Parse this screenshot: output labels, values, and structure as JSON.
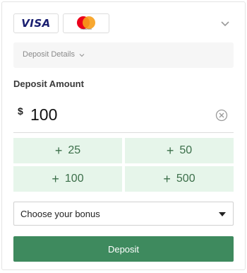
{
  "payment_methods": [
    {
      "name": "VISA",
      "icon": "visa-logo"
    },
    {
      "name": "Mastercard",
      "icon": "mastercard-logo",
      "sublabel": "mastercard"
    }
  ],
  "details": {
    "label": "Deposit Details"
  },
  "deposit": {
    "title": "Deposit Amount",
    "currency": "$",
    "amount": "100"
  },
  "quick_amounts": [
    {
      "plus": "+",
      "value": "25"
    },
    {
      "plus": "+",
      "value": "50"
    },
    {
      "plus": "+",
      "value": "100"
    },
    {
      "plus": "+",
      "value": "500"
    }
  ],
  "bonus_select": {
    "label": "Choose your bonus"
  },
  "submit": {
    "label": "Deposit"
  },
  "colors": {
    "accent": "#3e8a5e",
    "quick_bg": "#e6f5ea",
    "quick_text": "#3c6f4a",
    "visa_blue": "#1a1f71",
    "mc_red": "#eb001b",
    "mc_orange": "#f79e1b"
  }
}
